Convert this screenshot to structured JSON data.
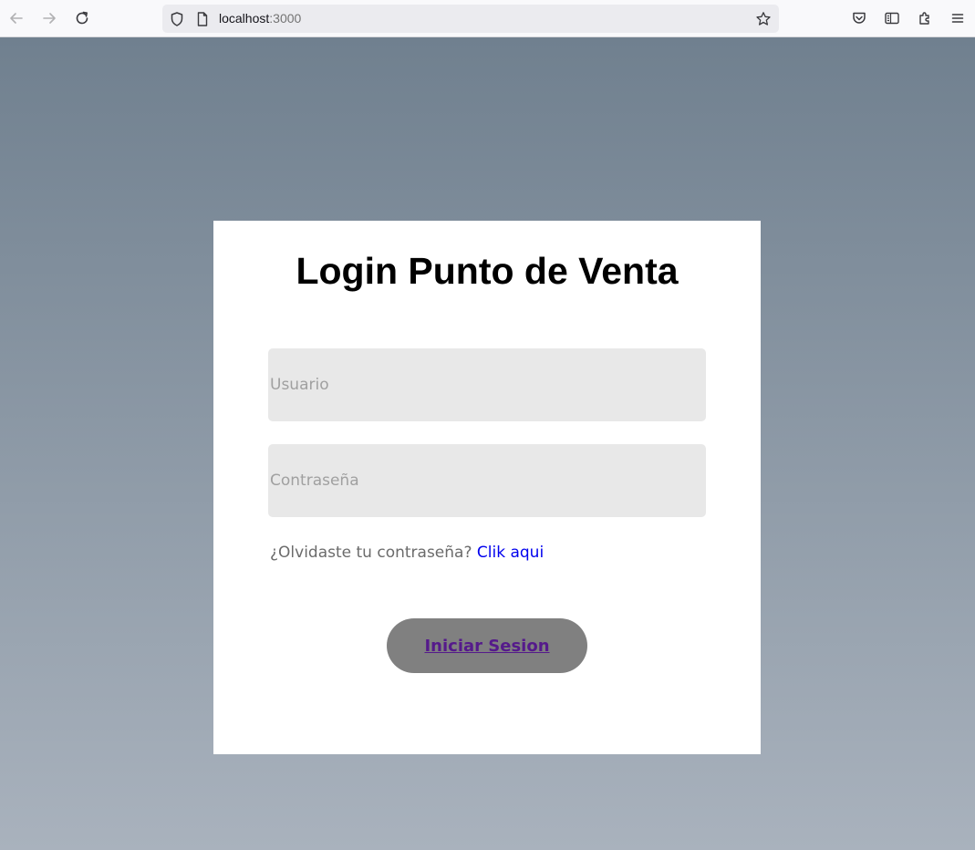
{
  "browser": {
    "url_host": "localhost",
    "url_port": ":3000",
    "icons": {
      "back": "arrow-left",
      "forward": "arrow-right",
      "reload": "reload",
      "site_info": "shield",
      "page": "page",
      "bookmark": "star",
      "pocket": "pocket",
      "sidebar": "sidebar",
      "extensions": "puzzle",
      "menu": "hamburger"
    },
    "colors": {
      "toolbar": "#f9f9fb",
      "urlbar": "#ebebef"
    }
  },
  "login": {
    "title": "Login Punto de Venta",
    "username_placeholder": "Usuario",
    "password_placeholder": "Contraseña",
    "forgot_text": "¿Olvidaste tu contraseña?",
    "forgot_link": "Clik aqui",
    "submit_label": "Iniciar Sesion",
    "colors": {
      "card": "#ffffff",
      "field": "#e8e8e8",
      "button": "#808080",
      "button_text": "#551a8b",
      "link": "#0000ee",
      "gradient_top": "#70808f",
      "gradient_bottom": "#a9b2bd"
    }
  }
}
